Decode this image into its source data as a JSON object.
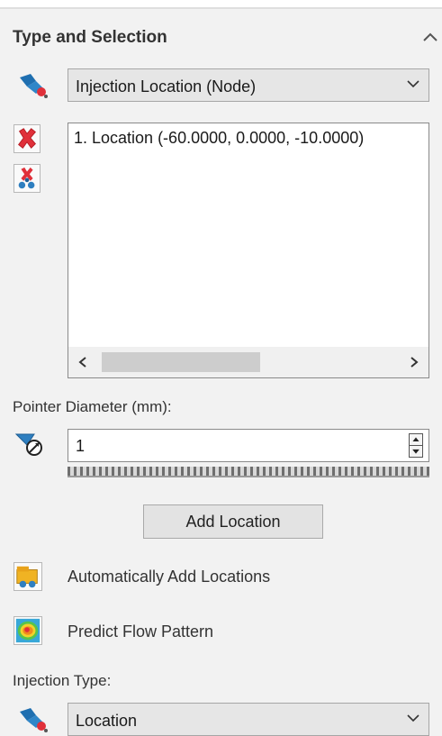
{
  "section": {
    "title": "Type and Selection"
  },
  "selection_type": {
    "value": "Injection Location (Node)"
  },
  "locations": {
    "items": [
      "1. Location (-60.0000, 0.0000, -10.0000)"
    ]
  },
  "pointer": {
    "label": "Pointer Diameter (mm):",
    "value": "1"
  },
  "add_location_label": "Add Location",
  "auto_add_label": "Automatically Add Locations",
  "predict_flow_label": "Predict Flow Pattern",
  "injection_type": {
    "label": "Injection Type:",
    "value": "Location"
  },
  "icons": {
    "node_picker": "injection-node-icon",
    "delete": "delete-icon",
    "delete_all": "delete-all-icon",
    "diameter": "pointer-diameter-icon",
    "auto_add": "auto-add-locations-icon",
    "predict_flow": "predict-flow-icon",
    "injection_type": "injection-type-icon"
  },
  "colors": {
    "accent_blue": "#2f7fc0",
    "delete_red": "#e0303a"
  }
}
